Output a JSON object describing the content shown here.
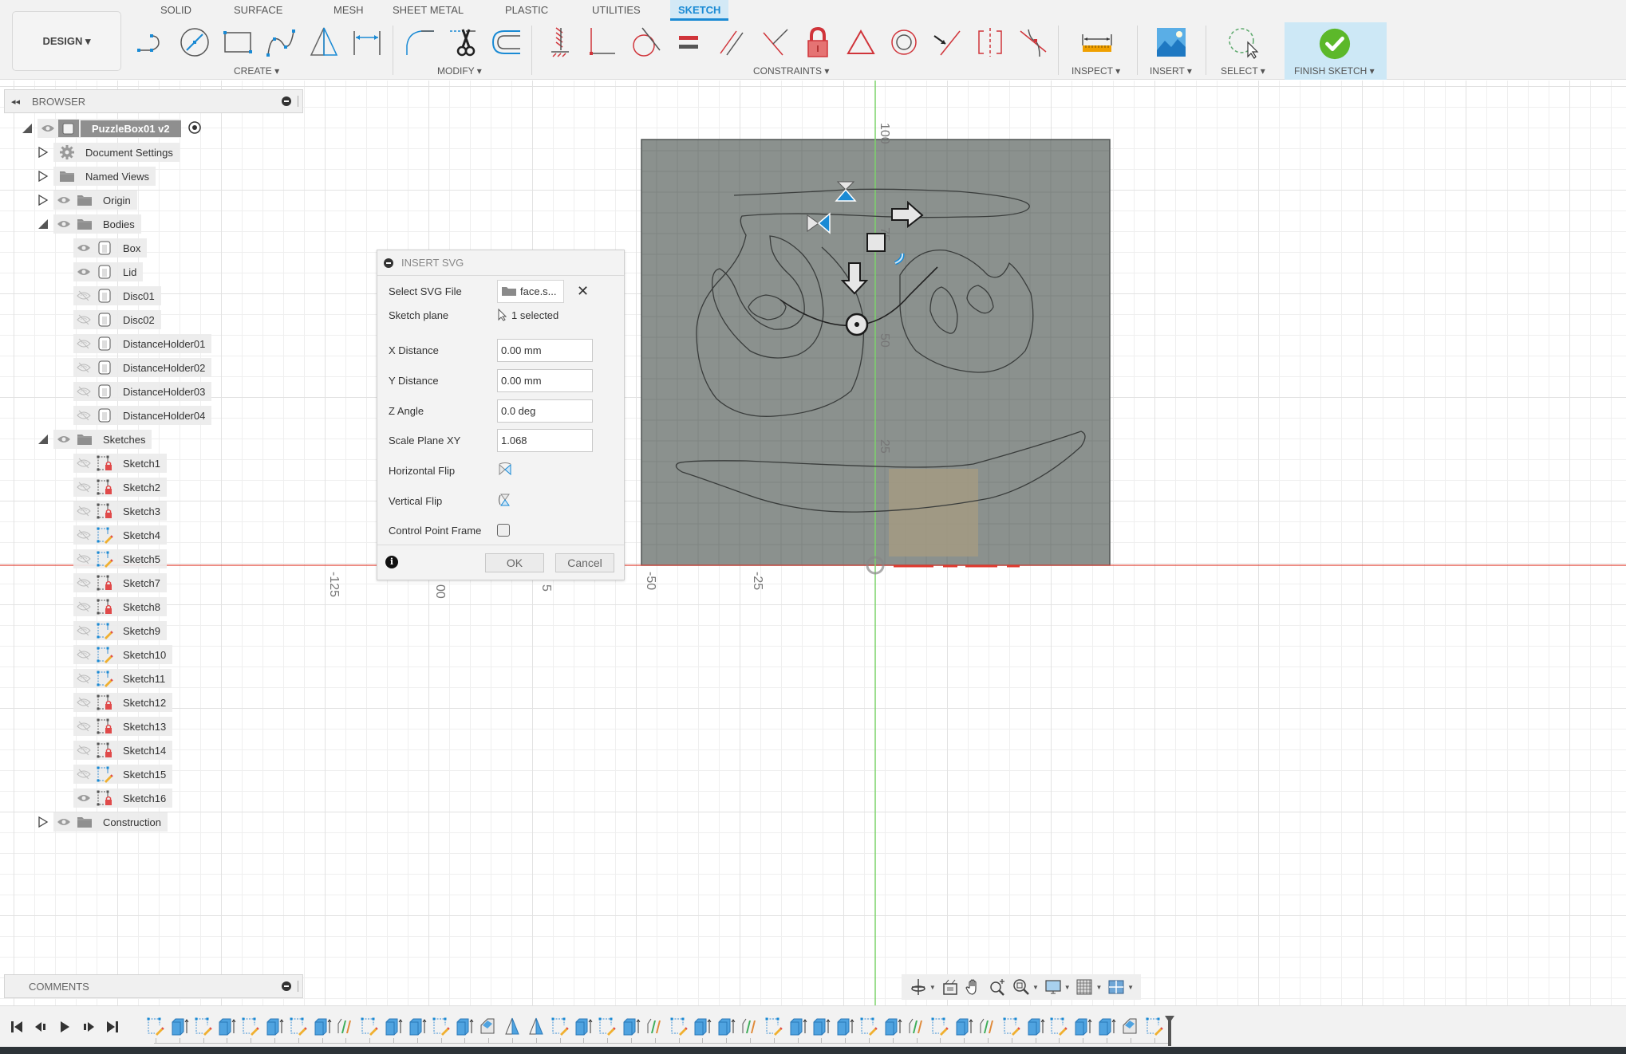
{
  "toolbar": {
    "workspace_button": "DESIGN ▾",
    "tabs": [
      {
        "label": "SOLID",
        "active": false
      },
      {
        "label": "SURFACE",
        "active": false
      },
      {
        "label": "MESH",
        "active": false
      },
      {
        "label": "SHEET METAL",
        "active": false
      },
      {
        "label": "PLASTIC",
        "active": false
      },
      {
        "label": "UTILITIES",
        "active": false
      },
      {
        "label": "SKETCH",
        "active": true
      }
    ],
    "groups": {
      "create": "CREATE ▾",
      "modify": "MODIFY ▾",
      "constraints": "CONSTRAINTS ▾",
      "inspect": "INSPECT ▾",
      "insert": "INSERT ▾",
      "select": "SELECT ▾",
      "finish": "FINISH SKETCH ▾"
    },
    "create_tools": [
      "line-icon",
      "circle-icon",
      "rectangle-icon",
      "spline-icon",
      "mirror-triangle-icon",
      "dimension-icon"
    ],
    "modify_tools": [
      "fillet-icon",
      "trim-scissors-icon",
      "offset-icon"
    ],
    "constraint_tools": [
      "fix-icon",
      "coincident-icon",
      "tangent-icon",
      "equal-icon",
      "parallel-icon",
      "perpendicular-icon",
      "lock-icon",
      "triangle-icon",
      "concentric-icon",
      "midpoint-icon",
      "symmetry-icon",
      "curvature-icon"
    ],
    "accent_color": "#1a8ad4",
    "constraint_color": "#d0343a",
    "finish_color": "#5cb82a"
  },
  "browser": {
    "title": "BROWSER",
    "root": "PuzzleBox01 v2",
    "items": [
      {
        "label": "Document Settings",
        "level": 1,
        "expander": "collapsed",
        "eye": "none",
        "icon": "gear-icon"
      },
      {
        "label": "Named Views",
        "level": 1,
        "expander": "collapsed",
        "eye": "none",
        "icon": "folder-icon"
      },
      {
        "label": "Origin",
        "level": 1,
        "expander": "collapsed",
        "eye": "visible",
        "icon": "folder-icon"
      },
      {
        "label": "Bodies",
        "level": 1,
        "expander": "expanded",
        "eye": "visible",
        "icon": "folder-icon"
      },
      {
        "label": "Box",
        "level": 2,
        "expander": "none",
        "eye": "visible",
        "icon": "body-icon"
      },
      {
        "label": "Lid",
        "level": 2,
        "expander": "none",
        "eye": "visible",
        "icon": "body-icon"
      },
      {
        "label": "Disc01",
        "level": 2,
        "expander": "none",
        "eye": "hidden",
        "icon": "body-icon"
      },
      {
        "label": "Disc02",
        "level": 2,
        "expander": "none",
        "eye": "hidden",
        "icon": "body-icon"
      },
      {
        "label": "DistanceHolder01",
        "level": 2,
        "expander": "none",
        "eye": "hidden",
        "icon": "body-icon"
      },
      {
        "label": "DistanceHolder02",
        "level": 2,
        "expander": "none",
        "eye": "hidden",
        "icon": "body-icon"
      },
      {
        "label": "DistanceHolder03",
        "level": 2,
        "expander": "none",
        "eye": "hidden",
        "icon": "body-icon"
      },
      {
        "label": "DistanceHolder04",
        "level": 2,
        "expander": "none",
        "eye": "hidden",
        "icon": "body-icon"
      },
      {
        "label": "Sketches",
        "level": 1,
        "expander": "expanded",
        "eye": "visible",
        "icon": "folder-icon"
      },
      {
        "label": "Sketch1",
        "level": 2,
        "expander": "none",
        "eye": "hidden",
        "icon": "sketch-locked-icon"
      },
      {
        "label": "Sketch2",
        "level": 2,
        "expander": "none",
        "eye": "hidden",
        "icon": "sketch-locked-icon"
      },
      {
        "label": "Sketch3",
        "level": 2,
        "expander": "none",
        "eye": "hidden",
        "icon": "sketch-locked-icon"
      },
      {
        "label": "Sketch4",
        "level": 2,
        "expander": "none",
        "eye": "hidden",
        "icon": "sketch-edit-icon"
      },
      {
        "label": "Sketch5",
        "level": 2,
        "expander": "none",
        "eye": "hidden",
        "icon": "sketch-edit-icon"
      },
      {
        "label": "Sketch7",
        "level": 2,
        "expander": "none",
        "eye": "hidden",
        "icon": "sketch-locked-icon"
      },
      {
        "label": "Sketch8",
        "level": 2,
        "expander": "none",
        "eye": "hidden",
        "icon": "sketch-locked-icon"
      },
      {
        "label": "Sketch9",
        "level": 2,
        "expander": "none",
        "eye": "hidden",
        "icon": "sketch-edit-icon"
      },
      {
        "label": "Sketch10",
        "level": 2,
        "expander": "none",
        "eye": "hidden",
        "icon": "sketch-edit-icon"
      },
      {
        "label": "Sketch11",
        "level": 2,
        "expander": "none",
        "eye": "hidden",
        "icon": "sketch-edit-icon"
      },
      {
        "label": "Sketch12",
        "level": 2,
        "expander": "none",
        "eye": "hidden",
        "icon": "sketch-locked-icon"
      },
      {
        "label": "Sketch13",
        "level": 2,
        "expander": "none",
        "eye": "hidden",
        "icon": "sketch-locked-icon"
      },
      {
        "label": "Sketch14",
        "level": 2,
        "expander": "none",
        "eye": "hidden",
        "icon": "sketch-locked-icon"
      },
      {
        "label": "Sketch15",
        "level": 2,
        "expander": "none",
        "eye": "hidden",
        "icon": "sketch-edit-icon"
      },
      {
        "label": "Sketch16",
        "level": 2,
        "expander": "none",
        "eye": "visible",
        "icon": "sketch-locked-icon"
      },
      {
        "label": "Construction",
        "level": 1,
        "expander": "collapsed",
        "eye": "visible",
        "icon": "folder-icon"
      }
    ]
  },
  "dialog": {
    "title": "INSERT SVG",
    "fields": {
      "select_svg_label": "Select SVG File",
      "select_svg_value": "face.s...",
      "sketch_plane_label": "Sketch plane",
      "sketch_plane_value": "1 selected",
      "x_distance_label": "X Distance",
      "x_distance_value": "0.00 mm",
      "y_distance_label": "Y Distance",
      "y_distance_value": "0.00 mm",
      "z_angle_label": "Z Angle",
      "z_angle_value": "0.0 deg",
      "scale_label": "Scale Plane XY",
      "scale_value": "1.068",
      "hflip_label": "Horizontal Flip",
      "vflip_label": "Vertical Flip",
      "control_frame_label": "Control Point Frame",
      "control_frame_checked": false
    },
    "ok_label": "OK",
    "cancel_label": "Cancel"
  },
  "canvas": {
    "vertical_axis_labels": [
      "100",
      "75",
      "50",
      "25"
    ],
    "horizontal_axis_labels": [
      "-125",
      "00",
      "5",
      "-50",
      "-25"
    ],
    "plane_color": "#8a908d",
    "x_axis_color": "#e04a3f",
    "y_axis_color": "#7dd36c"
  },
  "comments": {
    "title": "COMMENTS"
  },
  "navbar": {
    "tools": [
      "orbit-icon",
      "look-at-icon",
      "pan-hand-icon",
      "zoom-icon",
      "fit-zoom-icon",
      "display-settings-icon",
      "grid-icon",
      "viewports-icon"
    ]
  },
  "timeline": {
    "controls": [
      "skip-start-icon",
      "step-back-icon",
      "play-icon",
      "step-forward-icon",
      "skip-end-icon"
    ],
    "items": [
      "sketch",
      "extrude",
      "sketch",
      "extrude",
      "sketch",
      "extrude",
      "sketch",
      "extrude",
      "split",
      "sketch",
      "extrude",
      "extrude",
      "sketch",
      "extrude",
      "chamfer",
      "mirror",
      "mirror",
      "sketch",
      "extrude",
      "sketch",
      "extrude",
      "split",
      "sketch",
      "extrude",
      "extrude",
      "split",
      "sketch",
      "extrude",
      "extrude",
      "extrude",
      "sketch",
      "extrude",
      "split",
      "sketch",
      "extrude",
      "split",
      "sketch",
      "extrude",
      "sketch",
      "extrude",
      "extrude",
      "chamfer",
      "sketch"
    ]
  }
}
